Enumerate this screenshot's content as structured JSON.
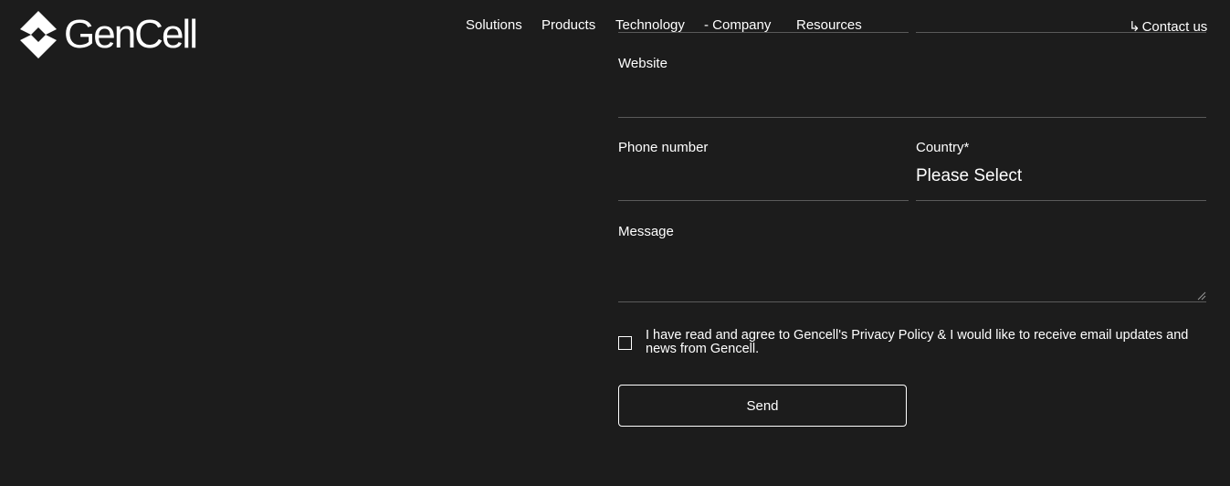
{
  "brand": {
    "name": "GenCell"
  },
  "nav": {
    "items": [
      {
        "label": "Solutions"
      },
      {
        "label": "Products"
      },
      {
        "label": "Technology"
      },
      {
        "label": "- Company"
      },
      {
        "label": "Resources"
      }
    ],
    "contact": {
      "arrow": "↳",
      "label": "Contact us"
    }
  },
  "form": {
    "website_label": "Website",
    "phone_label": "Phone number",
    "country_label": "Country*",
    "country_value": "Please Select",
    "message_label": "Message",
    "consent_text": "I have read and agree to Gencell's Privacy Policy & I would like to receive email updates and news from Gencell.",
    "consent_checked": false,
    "send_label": "Send"
  },
  "colors": {
    "background": "#1c1c1c",
    "text": "#ffffff",
    "field_line": "#5a5a5a"
  }
}
